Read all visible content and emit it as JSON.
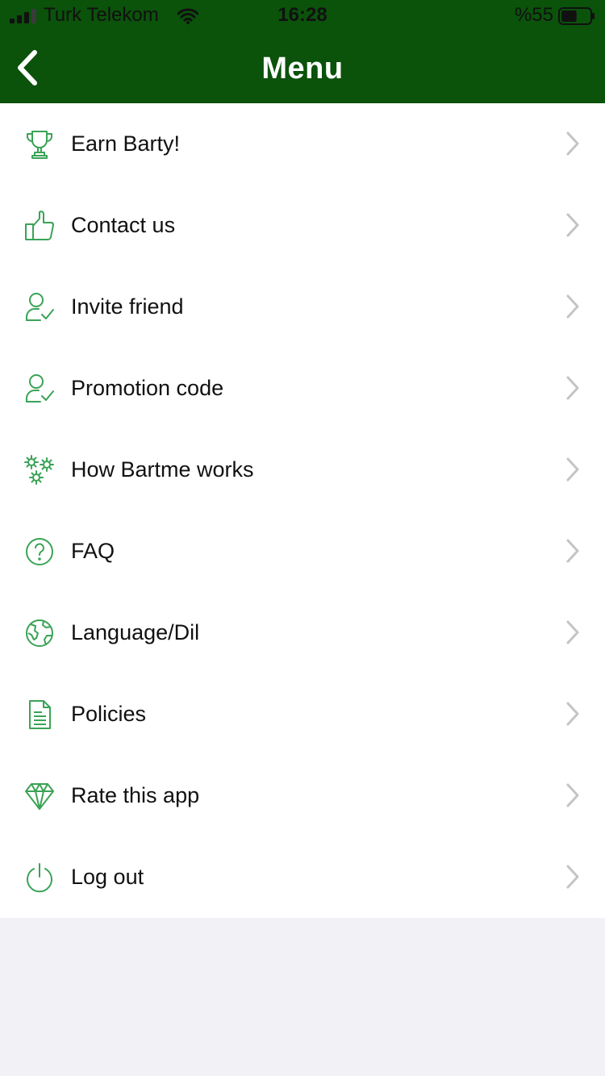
{
  "status_bar": {
    "carrier": "Turk Telekom",
    "time": "16:28",
    "battery_text": "%55",
    "battery_level": 0.55
  },
  "header": {
    "title": "Menu",
    "back_icon": "chevron-left-icon"
  },
  "colors": {
    "header_bg": "#0b520b",
    "icon_green": "#3aa356",
    "chevron_gray": "#c4c4c8",
    "list_bg": "#ffffff",
    "page_bg": "#f2f2f6"
  },
  "menu": {
    "items": [
      {
        "label": "Earn Barty!",
        "icon": "trophy-icon"
      },
      {
        "label": "Contact us",
        "icon": "thumbs-up-icon"
      },
      {
        "label": "Invite friend",
        "icon": "user-check-icon"
      },
      {
        "label": "Promotion code",
        "icon": "user-check-icon"
      },
      {
        "label": "How Bartme works",
        "icon": "gears-icon"
      },
      {
        "label": "FAQ",
        "icon": "question-circle-icon"
      },
      {
        "label": "Language/Dil",
        "icon": "globe-icon"
      },
      {
        "label": "Policies",
        "icon": "document-icon"
      },
      {
        "label": "Rate this app",
        "icon": "diamond-icon"
      },
      {
        "label": "Log out",
        "icon": "power-icon"
      }
    ]
  }
}
